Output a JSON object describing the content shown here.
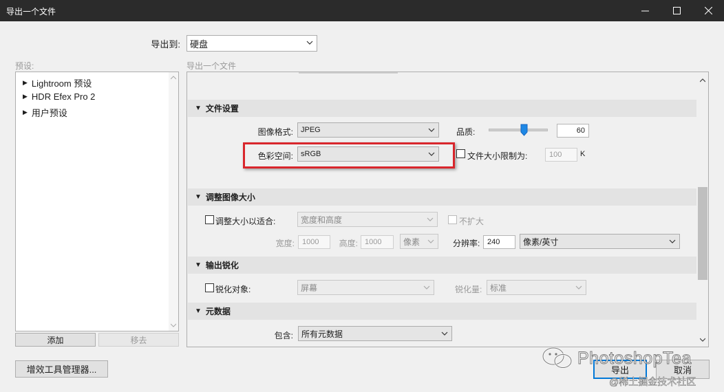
{
  "window": {
    "title": "导出一个文件"
  },
  "export_to": {
    "label": "导出到:",
    "value": "硬盘"
  },
  "presets": {
    "label": "预设:",
    "items": [
      {
        "label": "Lightroom 预设"
      },
      {
        "label": "HDR Efex Pro 2"
      },
      {
        "label": "用户预设"
      }
    ],
    "add_label": "添加",
    "remove_label": "移去"
  },
  "panel": {
    "heading": "导出一个文件"
  },
  "file_settings": {
    "title": "文件设置",
    "image_format_label": "图像格式:",
    "image_format_value": "JPEG",
    "quality_label": "品质:",
    "quality_value": "60",
    "quality_fraction": 0.6,
    "color_space_label": "色彩空间:",
    "color_space_value": "sRGB",
    "limit_label": "文件大小限制为:",
    "limit_value": "100",
    "limit_unit": "K"
  },
  "resize": {
    "title": "调整图像大小",
    "fit_label": "调整大小以适合:",
    "fit_value": "宽度和高度",
    "no_enlarge_label": "不扩大",
    "width_label": "宽度:",
    "width_value": "1000",
    "height_label": "高度:",
    "height_value": "1000",
    "unit_value": "像素",
    "resolution_label": "分辨率:",
    "resolution_value": "240",
    "resolution_unit": "像素/英寸"
  },
  "sharpen": {
    "title": "输出锐化",
    "target_label": "锐化对象:",
    "target_value": "屏幕",
    "amount_label": "锐化量:",
    "amount_value": "标准"
  },
  "metadata": {
    "title": "元数据",
    "include_label": "包含:",
    "include_value": "所有元数据"
  },
  "footer": {
    "plugin_manager_label": "增效工具管理器...",
    "export_label": "导出",
    "cancel_label": "取消"
  },
  "watermark": {
    "brand": "PhotoshopTea",
    "credit": "@稀土掘金技术社区"
  },
  "colors": {
    "highlight": "#d9262c",
    "titlebar": "#2b2b2b"
  }
}
